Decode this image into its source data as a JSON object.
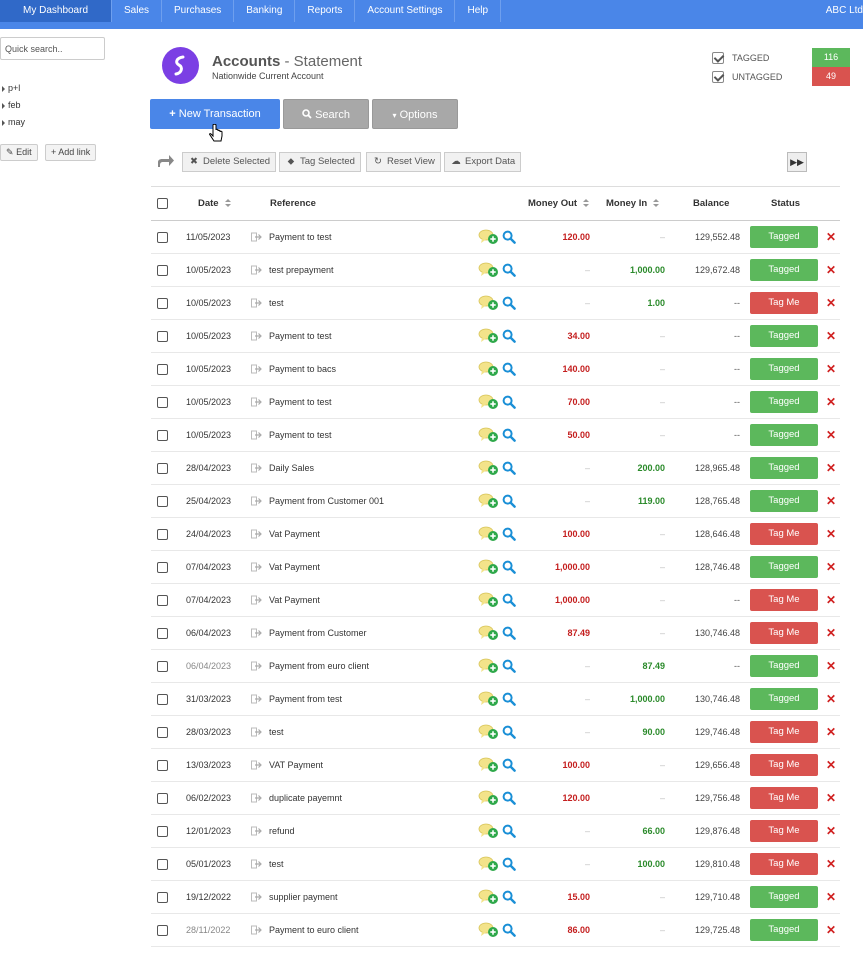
{
  "nav": {
    "items": [
      "My Dashboard",
      "Sales",
      "Purchases",
      "Banking",
      "Reports",
      "Account Settings",
      "Help"
    ],
    "company": "ABC Ltd"
  },
  "sidebar": {
    "search_placeholder": "Quick search..",
    "links": [
      "p+l",
      "feb",
      "may"
    ],
    "edit_label": "Edit",
    "add_link_label": "Add link"
  },
  "header": {
    "title": "Accounts",
    "subtitle": "- Statement",
    "account_name": "Nationwide Current Account",
    "tagged_label": "TAGGED",
    "tagged_count": "116",
    "untagged_label": "UNTAGGED",
    "untagged_count": "49",
    "colors": {
      "tagged": "#5cb85c",
      "untagged": "#d9534f",
      "primary": "#4a86e8",
      "logo": "#7b3fe4"
    }
  },
  "actions": {
    "new_transaction": "New Transaction",
    "search": "Search",
    "options": "Options"
  },
  "toolbar": {
    "delete_selected": "Delete Selected",
    "tag_selected": "Tag Selected",
    "reset_view": "Reset View",
    "export_data": "Export Data"
  },
  "table": {
    "headers": {
      "date": "Date",
      "reference": "Reference",
      "money_out": "Money Out",
      "money_in": "Money In",
      "balance": "Balance",
      "status": "Status"
    },
    "rows": [
      {
        "date": "11/05/2023",
        "ref": "Payment to test",
        "out": "120.00",
        "in": "–",
        "bal": "129,552.48",
        "status": "Tagged"
      },
      {
        "date": "10/05/2023",
        "ref": "test prepayment",
        "out": "–",
        "in": "1,000.00",
        "bal": "129,672.48",
        "status": "Tagged"
      },
      {
        "date": "10/05/2023",
        "ref": "test",
        "out": "–",
        "in": "1.00",
        "bal": "--",
        "status": "Tag Me"
      },
      {
        "date": "10/05/2023",
        "ref": "Payment to test",
        "out": "34.00",
        "in": "–",
        "bal": "--",
        "status": "Tagged"
      },
      {
        "date": "10/05/2023",
        "ref": "Payment to bacs",
        "out": "140.00",
        "in": "–",
        "bal": "--",
        "status": "Tagged"
      },
      {
        "date": "10/05/2023",
        "ref": "Payment to test",
        "out": "70.00",
        "in": "–",
        "bal": "--",
        "status": "Tagged"
      },
      {
        "date": "10/05/2023",
        "ref": "Payment to test",
        "out": "50.00",
        "in": "–",
        "bal": "--",
        "status": "Tagged"
      },
      {
        "date": "28/04/2023",
        "ref": "Daily Sales",
        "out": "–",
        "in": "200.00",
        "bal": "128,965.48",
        "status": "Tagged"
      },
      {
        "date": "25/04/2023",
        "ref": "Payment from Customer 001",
        "out": "–",
        "in": "119.00",
        "bal": "128,765.48",
        "status": "Tagged"
      },
      {
        "date": "24/04/2023",
        "ref": "Vat Payment",
        "out": "100.00",
        "in": "–",
        "bal": "128,646.48",
        "status": "Tag Me"
      },
      {
        "date": "07/04/2023",
        "ref": "Vat Payment",
        "out": "1,000.00",
        "in": "–",
        "bal": "128,746.48",
        "status": "Tagged"
      },
      {
        "date": "07/04/2023",
        "ref": "Vat Payment",
        "out": "1,000.00",
        "in": "–",
        "bal": "--",
        "status": "Tag Me"
      },
      {
        "date": "06/04/2023",
        "ref": "Payment from Customer",
        "out": "87.49",
        "in": "–",
        "bal": "130,746.48",
        "status": "Tag Me"
      },
      {
        "date": "06/04/2023",
        "ref": "Payment from euro client",
        "out": "–",
        "in": "87.49",
        "bal": "--",
        "status": "Tagged",
        "muted": true
      },
      {
        "date": "31/03/2023",
        "ref": "Payment from test",
        "out": "–",
        "in": "1,000.00",
        "bal": "130,746.48",
        "status": "Tagged"
      },
      {
        "date": "28/03/2023",
        "ref": "test",
        "out": "–",
        "in": "90.00",
        "bal": "129,746.48",
        "status": "Tag Me"
      },
      {
        "date": "13/03/2023",
        "ref": "VAT Payment",
        "out": "100.00",
        "in": "–",
        "bal": "129,656.48",
        "status": "Tag Me"
      },
      {
        "date": "06/02/2023",
        "ref": "duplicate payemnt",
        "out": "120.00",
        "in": "–",
        "bal": "129,756.48",
        "status": "Tag Me"
      },
      {
        "date": "12/01/2023",
        "ref": "refund",
        "out": "–",
        "in": "66.00",
        "bal": "129,876.48",
        "status": "Tag Me"
      },
      {
        "date": "05/01/2023",
        "ref": "test",
        "out": "–",
        "in": "100.00",
        "bal": "129,810.48",
        "status": "Tag Me"
      },
      {
        "date": "19/12/2022",
        "ref": "supplier payment",
        "out": "15.00",
        "in": "–",
        "bal": "129,710.48",
        "status": "Tagged"
      },
      {
        "date": "28/11/2022",
        "ref": "Payment to euro client",
        "out": "86.00",
        "in": "–",
        "bal": "129,725.48",
        "status": "Tagged",
        "muted": true
      }
    ]
  }
}
